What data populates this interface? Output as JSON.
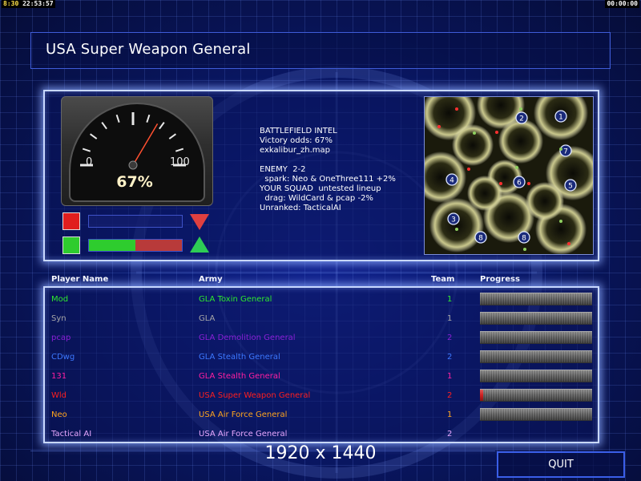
{
  "hud": {
    "left_prefix": "8:30",
    "left_clock": "22:53:57",
    "right_clock": "00:00:00"
  },
  "title": "USA Super Weapon General",
  "gauge": {
    "min_label": "0",
    "max_label": "100",
    "percent_label": "67%",
    "value": 67
  },
  "odds_bars": [
    {
      "swatch_color": "#e01e1e",
      "fill_fraction": 0.0,
      "arrow": "down",
      "arrow_color": "#e04040"
    },
    {
      "swatch_color": "#2ecc2e",
      "fill_fraction": 1.0,
      "green_part": 0.5,
      "red_part": 0.5,
      "arrow": "up",
      "arrow_color": "#2ecc55"
    }
  ],
  "intel": {
    "lines": [
      "BATTLEFIELD INTEL",
      "Victory odds: 67%",
      "exkalibur_zh.map",
      "",
      "ENEMY  2-2",
      "  spark: Neo & OneThree111 +2%",
      "YOUR SQUAD  untested lineup",
      "  drag: WildCard & pcap -2%",
      "Unranked: TacticalAI"
    ]
  },
  "minimap": {
    "start_positions": [
      "1",
      "2",
      "3",
      "4",
      "5",
      "6",
      "7",
      "8"
    ]
  },
  "table": {
    "headers": {
      "player_name": "Player Name",
      "army": "Army",
      "team": "Team",
      "progress": "Progress"
    },
    "rows": [
      {
        "name": "Mod",
        "army": "GLA Toxin General",
        "team": "1",
        "color": "#2ee82e",
        "progress": 0.0,
        "show_progress": true
      },
      {
        "name": "Syn",
        "army": "GLA",
        "team": "1",
        "color": "#a8a8a8",
        "progress": 0.0,
        "show_progress": true
      },
      {
        "name": "pcap",
        "army": "GLA Demolition General",
        "team": "2",
        "color": "#8a1fd6",
        "progress": 0.0,
        "show_progress": true
      },
      {
        "name": "CDwg",
        "army": "GLA Stealth General",
        "team": "2",
        "color": "#3c78ff",
        "progress": 0.0,
        "show_progress": true
      },
      {
        "name": "131",
        "army": "GLA Stealth General",
        "team": "1",
        "color": "#ff1fa0",
        "progress": 0.0,
        "show_progress": true
      },
      {
        "name": "Wld",
        "army": "USA Super Weapon General",
        "team": "2",
        "color": "#ff1e1e",
        "progress": 0.03,
        "show_progress": true
      },
      {
        "name": "Neo",
        "army": "USA Air Force General",
        "team": "1",
        "color": "#ffa51e",
        "progress": 0.0,
        "show_progress": true
      },
      {
        "name": "Tactical AI",
        "army": "USA Air Force General",
        "team": "2",
        "color": "#e8a8ff",
        "progress": 0.0,
        "show_progress": false
      }
    ]
  },
  "resolution": "1920 x 1440",
  "quit_label": "QUIT"
}
